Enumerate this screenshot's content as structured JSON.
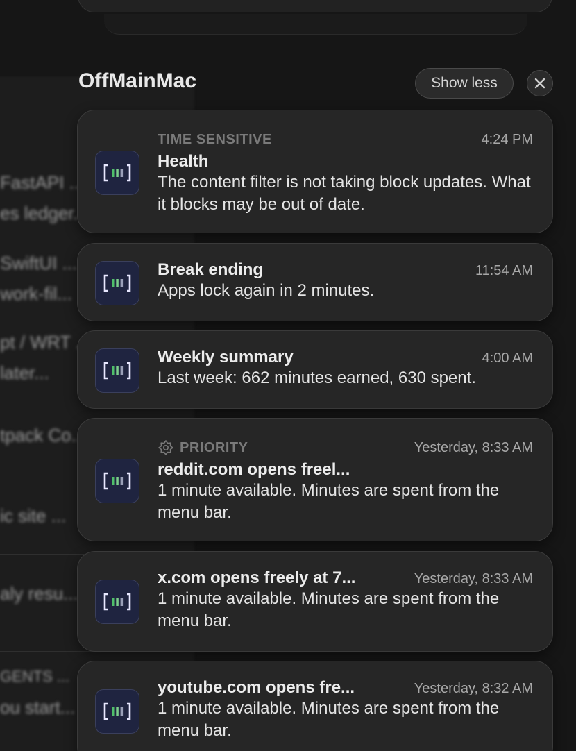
{
  "background": {
    "lines": [
      "FastAPI ...",
      "es ledger...",
      "SwiftUI ...",
      "work-fil...",
      "pt / WRT ...",
      "later...",
      "tpack Co...",
      "ic site ...",
      "aly resu...",
      "GENTS ...",
      "ou start..."
    ]
  },
  "group": {
    "title": "OffMainMac",
    "show_less_label": "Show less"
  },
  "notifications": [
    {
      "label": "TIME SENSITIVE",
      "time": "4:24 PM",
      "title": "Health",
      "body": "The content filter is not taking block updates. What it blocks may be out of date."
    },
    {
      "label": "",
      "time": "11:54 AM",
      "title": "Break ending",
      "body": "Apps lock again in 2 minutes."
    },
    {
      "label": "",
      "time": "4:00 AM",
      "title": "Weekly summary",
      "body": "Last week: 662 minutes earned, 630 spent."
    },
    {
      "label": "PRIORITY",
      "time": "Yesterday, 8:33 AM",
      "title": "reddit.com opens freel...",
      "body": "1 minute available. Minutes are spent from the menu bar."
    },
    {
      "label": "",
      "time": "Yesterday, 8:33 AM",
      "title": "x.com opens freely at 7...",
      "body": "1 minute available. Minutes are spent from the menu bar."
    },
    {
      "label": "",
      "time": "Yesterday, 8:32 AM",
      "title": "youtube.com opens fre...",
      "body": "1 minute available. Minutes are spent from the menu bar."
    }
  ],
  "colors": {
    "icon_bg": "#1f2440",
    "icon_bracket": "#e8e8ff",
    "icon_bar_green": "#4fbf6a"
  }
}
